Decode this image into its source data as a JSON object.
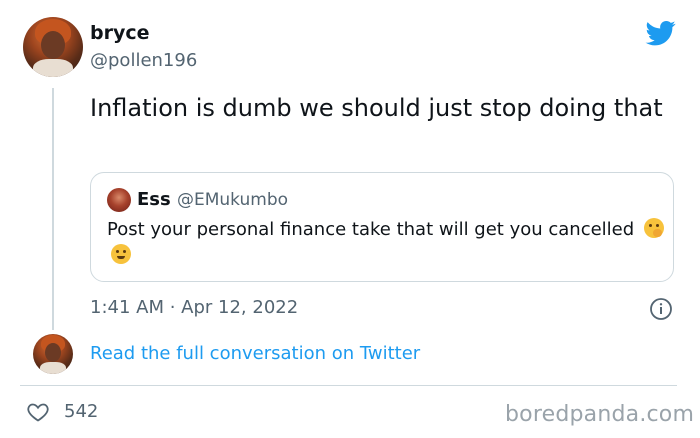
{
  "tweet": {
    "author_name": "bryce",
    "author_handle": "@pollen196",
    "text": "Inflation is dumb we should just stop doing that",
    "timestamp": "1:41 AM · Apr 12, 2022",
    "read_more": "Read the full conversation on Twitter",
    "likes": "542"
  },
  "quoted_tweet": {
    "author_name": "Ess",
    "author_handle": "@EMukumbo",
    "text": "Post your personal finance take that will get you cancelled"
  },
  "watermark": "boredpanda.com",
  "colors": {
    "accent": "#1d9bf0",
    "text": "#0f1419",
    "muted": "#536471",
    "border": "#cfd9de"
  },
  "icons": [
    "twitter-bird-icon",
    "info-icon",
    "heart-icon",
    "shushing-face-emoji",
    "thinking-face-emoji"
  ]
}
